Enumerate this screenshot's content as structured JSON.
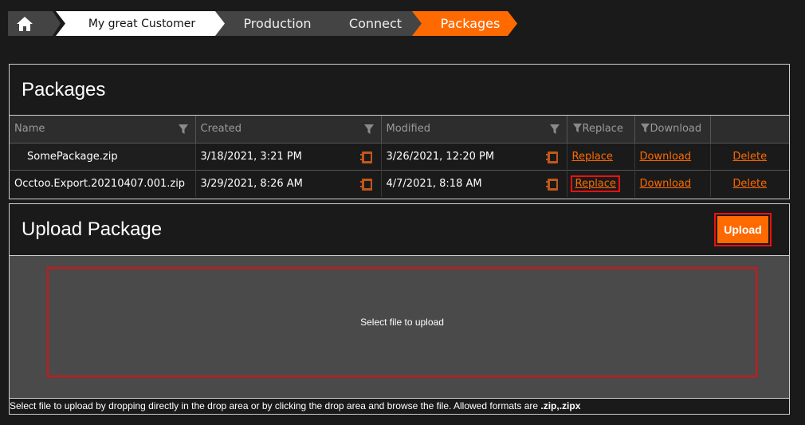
{
  "breadcrumb": {
    "home_icon": "home-icon",
    "items": [
      "My great Customer",
      "Production",
      "Connect",
      "Packages"
    ]
  },
  "packages": {
    "title": "Packages",
    "columns": [
      "Name",
      "Created",
      "Modified",
      "Replace",
      "Download"
    ],
    "rows": [
      {
        "name": "SomePackage.zip",
        "created": "3/18/2021, 3:21 PM",
        "modified": "3/26/2021, 12:20 PM",
        "replace": "Replace",
        "download": "Download",
        "delete": "Delete"
      },
      {
        "name": "Occtoo.Export.20210407.001.zip",
        "created": "3/29/2021, 8:26 AM",
        "modified": "4/7/2021, 8:18 AM",
        "replace": "Replace",
        "download": "Download",
        "delete": "Delete"
      }
    ]
  },
  "upload": {
    "title": "Upload Package",
    "button_label": "Upload",
    "drop_text": "Select file to upload",
    "hint_text": "Select file to upload by dropping directly in the drop area or by clicking the drop area and browse the file. Allowed formats are ",
    "hint_formats": ".zip,.zipx"
  },
  "colors": {
    "accent": "#ff6a00",
    "highlight": "#ee1111",
    "background": "#1a1a1a"
  }
}
